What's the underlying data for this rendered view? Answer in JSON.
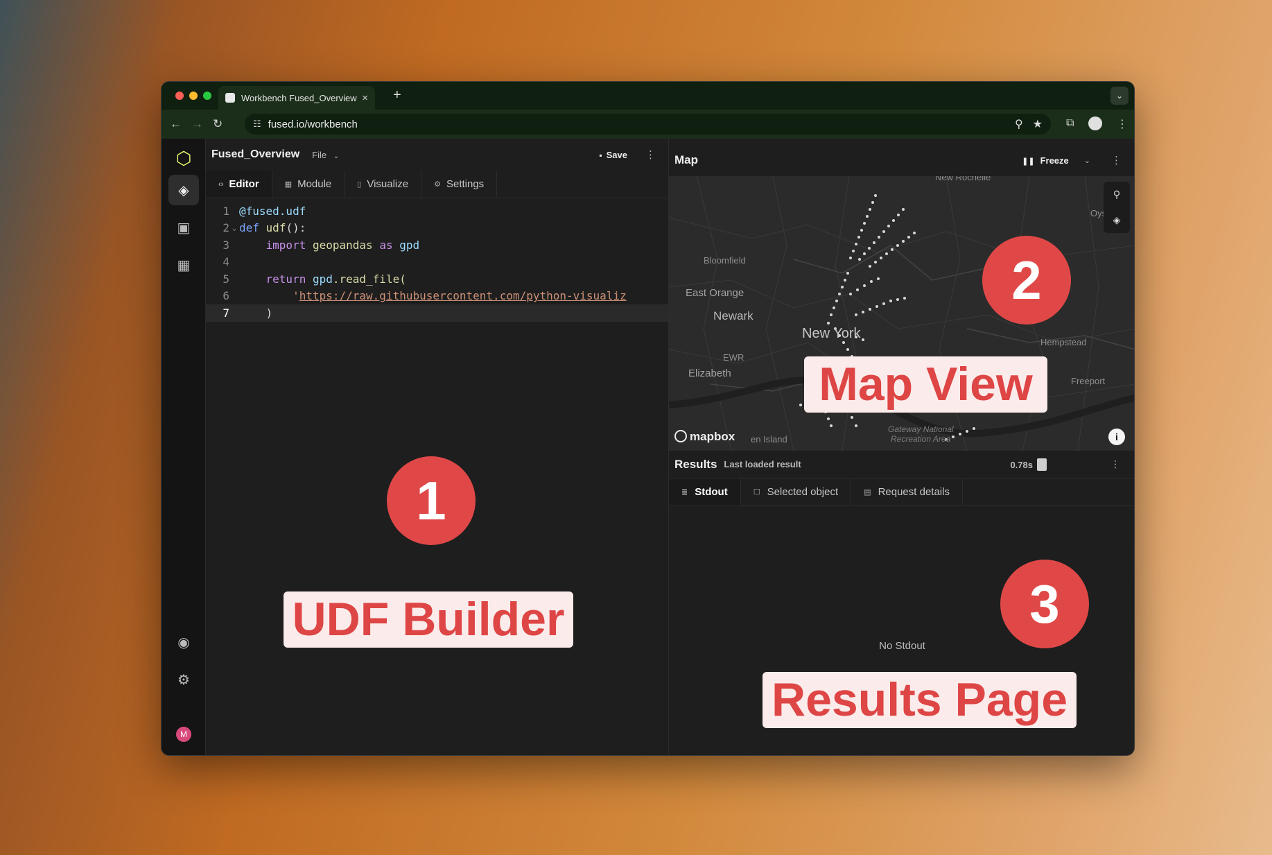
{
  "browser": {
    "tab_title": "Workbench Fused_Overview",
    "tab_close": "×",
    "new_tab": "+",
    "url": "fused.io/workbench"
  },
  "editor": {
    "project_name": "Fused_Overview",
    "file_menu": "File",
    "save_label": "Save",
    "tabs": [
      {
        "label": "Editor"
      },
      {
        "label": "Module"
      },
      {
        "label": "Visualize"
      },
      {
        "label": "Settings"
      }
    ],
    "line_numbers": [
      "1",
      "2",
      "3",
      "4",
      "5",
      "6",
      "7"
    ],
    "code": {
      "decorator": "@fused.udf",
      "def_kw": "def",
      "fn_name": "udf",
      "fn_sig": "():",
      "import_kw": "import",
      "module": "geopandas",
      "as_kw": "as",
      "alias": "gpd",
      "return_kw": "return",
      "call_obj": "gpd",
      "call_fn": ".read_file(",
      "string_quote": "'",
      "string_url": "https://raw.githubusercontent.com/python-visualiz",
      "close_paren": ")"
    }
  },
  "map": {
    "title": "Map",
    "freeze_label": "Freeze",
    "labels": {
      "new_rochelle": "New Rochelle",
      "oyster_bay": "Oyster B",
      "bloomfield": "Bloomfield",
      "east_orange": "East Orange",
      "newark": "Newark",
      "new_york": "New York",
      "hempstead": "Hempstead",
      "ewr": "EWR",
      "elizabeth": "Elizabeth",
      "freeport": "Freeport",
      "staten_island": "en Island",
      "gateway_1": "Gateway National",
      "gateway_2": "Recreation Area"
    },
    "attribution": "mapbox",
    "info": "i"
  },
  "results": {
    "title": "Results",
    "subtitle": "Last loaded result",
    "timing": "0.78s",
    "tabs": [
      {
        "label": "Stdout"
      },
      {
        "label": "Selected object"
      },
      {
        "label": "Request details"
      }
    ],
    "empty_message": "No Stdout"
  },
  "annotations": [
    {
      "number": "1",
      "label": "UDF Builder"
    },
    {
      "number": "2",
      "label": "Map View"
    },
    {
      "number": "3",
      "label": "Results Page"
    }
  ],
  "colors": {
    "badge": "#e04848",
    "callout_bg": "#fbeceb",
    "callout_text": "#de4545",
    "logo": "#e8f56a"
  }
}
